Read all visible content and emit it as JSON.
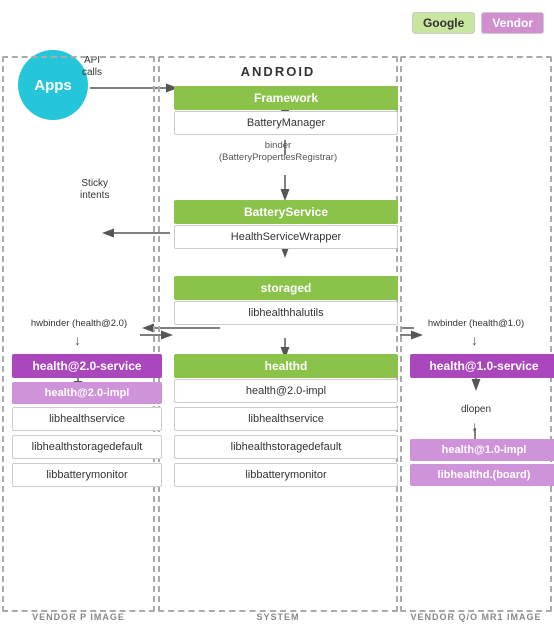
{
  "legend": {
    "google_label": "Google",
    "vendor_label": "Vendor"
  },
  "header": {
    "android_label": "ANDROID"
  },
  "center_column": {
    "title": "ANDROID",
    "framework": "Framework",
    "battery_manager": "BatteryManager",
    "binder_label": "binder\n(BatteryPropertiesRegistrar)",
    "battery_service": "BatteryService",
    "health_service_wrapper": "HealthServiceWrapper",
    "storaged": "storaged",
    "libhealthhalutils": "libhealthhalutils",
    "healthd": "healthd",
    "health_20_impl": "health@2.0-impl",
    "libhealthservice": "libhealthservice",
    "libhealthstoragedefault": "libhealthstoragedefault",
    "libbatterymonitor": "libbatterymonitor",
    "footer": "SYSTEM"
  },
  "left_column": {
    "apps_label": "Apps",
    "api_calls": "API\ncalls",
    "sticky_intents": "Sticky\nintents",
    "hwbinder": "hwbinder (health@2.0)",
    "health_service": "health@2.0-service",
    "health_impl": "health@2.0-impl",
    "libhealthservice": "libhealthservice",
    "libhealthstoragedefault": "libhealthstoragedefault",
    "libbatterymonitor": "libbatterymonitor",
    "footer": "VENDOR P IMAGE"
  },
  "right_column": {
    "hwbinder": "hwbinder (health@1.0)",
    "health_service": "health@1.0-service",
    "dlopen": "dlopen",
    "health_impl": "health@1.0-impl",
    "libhealthd_board": "libhealthd.(board)",
    "footer": "VENDOR Q/O MR1 IMAGE"
  }
}
